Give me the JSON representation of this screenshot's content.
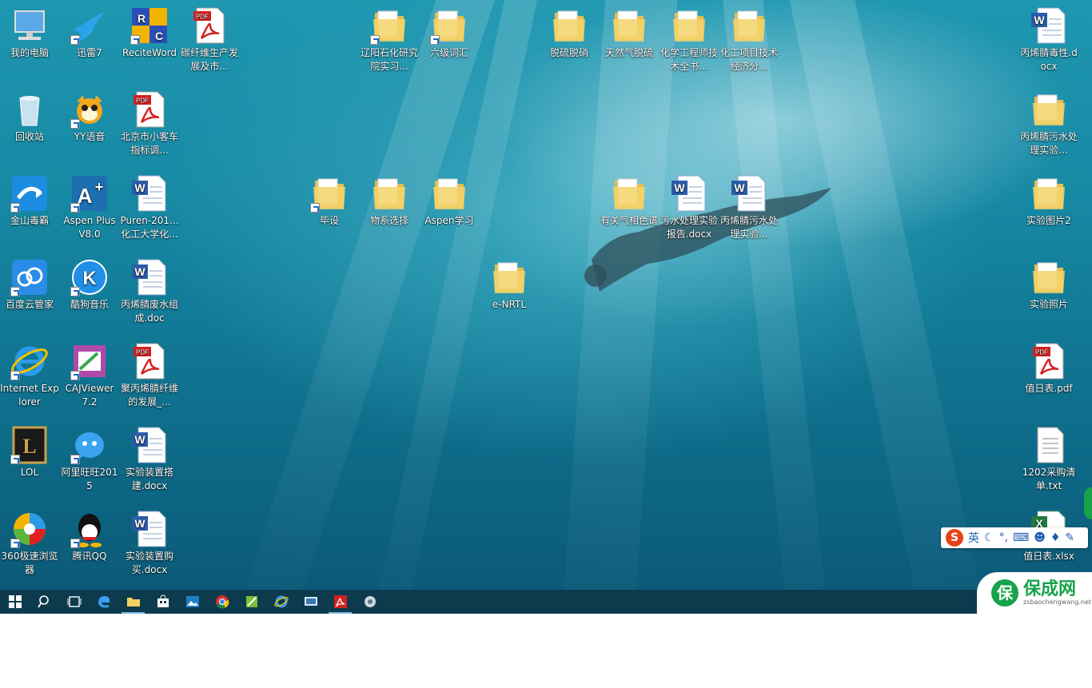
{
  "desktop": {
    "icons": [
      {
        "label": "我的电脑",
        "icon": "computer-icon"
      },
      {
        "label": "迅雷7",
        "icon": "thunder-bird-icon"
      },
      {
        "label": "ReciteWord",
        "icon": "reciteword-icon"
      },
      {
        "label": "碳纤维生产发展及市...",
        "icon": "pdf-icon"
      },
      {
        "label": "回收站",
        "icon": "recycle-bin-icon"
      },
      {
        "label": "YY语音",
        "icon": "yy-icon"
      },
      {
        "label": "北京市小客车指标调...",
        "icon": "pdf-icon"
      },
      {
        "label": "金山毒霸",
        "icon": "kingsoft-icon"
      },
      {
        "label": "Aspen Plus V8.0",
        "icon": "aspen-icon"
      },
      {
        "label": "Puren-201...化工大学化...",
        "icon": "word-icon"
      },
      {
        "label": "百度云管家",
        "icon": "baidu-cloud-icon"
      },
      {
        "label": "酷狗音乐",
        "icon": "kugou-icon"
      },
      {
        "label": "丙烯腈废水组成.doc",
        "icon": "word-icon"
      },
      {
        "label": "Internet Explorer",
        "icon": "ie-icon"
      },
      {
        "label": "CAJViewer 7.2",
        "icon": "cajviewer-icon"
      },
      {
        "label": "聚丙烯腈纤维的发展_...",
        "icon": "pdf-icon"
      },
      {
        "label": "LOL",
        "icon": "lol-icon"
      },
      {
        "label": "阿里旺旺2015",
        "icon": "aliwangwang-icon"
      },
      {
        "label": "实验装置搭建.docx",
        "icon": "word-icon"
      },
      {
        "label": "360极速浏览器",
        "icon": "browser-360-icon"
      },
      {
        "label": "腾讯QQ",
        "icon": "qq-icon"
      },
      {
        "label": "实验装置购买.docx",
        "icon": "word-icon"
      },
      {
        "label": "辽阳石化研究院实习...",
        "icon": "folder-icon"
      },
      {
        "label": "六级词汇",
        "icon": "folder-icon"
      },
      {
        "label": "毕设",
        "icon": "folder-icon"
      },
      {
        "label": "物系选择",
        "icon": "folder-icon"
      },
      {
        "label": "Aspen学习",
        "icon": "folder-icon"
      },
      {
        "label": "e-NRTL",
        "icon": "folder-icon"
      },
      {
        "label": "脱硫脱硝",
        "icon": "folder-icon"
      },
      {
        "label": "天然气脱硫",
        "icon": "folder-icon"
      },
      {
        "label": "化学工程师技术全书...",
        "icon": "folder-icon"
      },
      {
        "label": "化工项目技术经济分...",
        "icon": "folder-icon"
      },
      {
        "label": "有关气相色谱",
        "icon": "folder-icon"
      },
      {
        "label": "污水处理实验报告.docx",
        "icon": "word-icon"
      },
      {
        "label": "丙烯腈污水处理实验...",
        "icon": "word-icon"
      },
      {
        "label": "丙烯腈毒性.docx",
        "icon": "word-icon"
      },
      {
        "label": "丙烯腈污水处理实验...",
        "icon": "folder-icon"
      },
      {
        "label": "实验图片2",
        "icon": "folder-icon"
      },
      {
        "label": "实验照片",
        "icon": "folder-icon"
      },
      {
        "label": "值日表.pdf",
        "icon": "pdf-icon"
      },
      {
        "label": "1202采购清单.txt",
        "icon": "txt-icon"
      },
      {
        "label": "值日表.xlsx",
        "icon": "excel-icon"
      }
    ]
  },
  "ime": {
    "lang": "英",
    "logo": "S"
  },
  "taskbar": {
    "apps": [
      "start",
      "search",
      "task-view",
      "edge",
      "file-explorer",
      "store",
      "photos",
      "chrome",
      "sheets",
      "ie",
      "remote",
      "acrobat",
      "hardware"
    ]
  },
  "watermark": {
    "logo": "保",
    "title": "保成网",
    "subtitle": "zsbaochengwang.net"
  },
  "colors": {
    "taskbar": "#0e3a4e",
    "folder": "#f2d061",
    "pdf_red": "#d32020",
    "word_blue": "#2b5caa"
  }
}
